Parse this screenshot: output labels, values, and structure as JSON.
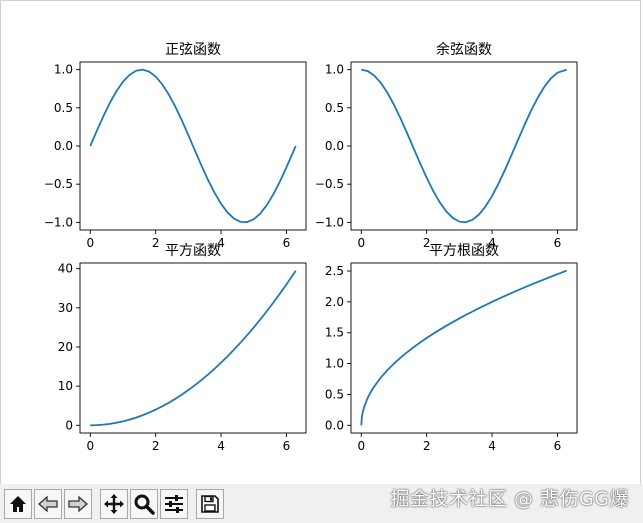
{
  "chart_data": [
    {
      "type": "line",
      "title": "正弦函数",
      "xlim": [
        -0.3141,
        6.5973
      ],
      "ylim": [
        -1.1,
        1.1
      ],
      "xticks": [
        0,
        2,
        4,
        6
      ],
      "yticks": [
        -1.0,
        -0.5,
        0.0,
        0.5,
        1.0
      ],
      "ytick_labels": [
        "−1.0",
        "−0.5",
        "0.0",
        "0.5",
        "1.0"
      ],
      "x": [
        0,
        0.2,
        0.4,
        0.6,
        0.8,
        1.0,
        1.2,
        1.4,
        1.6,
        1.8,
        2.0,
        2.2,
        2.4,
        2.6,
        2.8,
        3.0,
        3.2,
        3.4,
        3.6,
        3.8,
        4.0,
        4.2,
        4.4,
        4.6,
        4.8,
        5.0,
        5.2,
        5.4,
        5.6,
        5.8,
        6.0,
        6.283
      ],
      "y": [
        0,
        0.199,
        0.389,
        0.565,
        0.717,
        0.841,
        0.932,
        0.985,
        1.0,
        0.974,
        0.909,
        0.808,
        0.675,
        0.516,
        0.335,
        0.141,
        -0.058,
        -0.256,
        -0.443,
        -0.612,
        -0.757,
        -0.872,
        -0.952,
        -0.994,
        -0.996,
        -0.959,
        -0.883,
        -0.773,
        -0.631,
        -0.465,
        -0.279,
        0.0
      ],
      "color": "#1f77b4"
    },
    {
      "type": "line",
      "title": "余弦函数",
      "xlim": [
        -0.3141,
        6.5973
      ],
      "ylim": [
        -1.1,
        1.1
      ],
      "xticks": [
        0,
        2,
        4,
        6
      ],
      "yticks": [
        -1.0,
        -0.5,
        0.0,
        0.5,
        1.0
      ],
      "ytick_labels": [
        "−1.0",
        "−0.5",
        "0.0",
        "0.5",
        "1.0"
      ],
      "x": [
        0,
        0.2,
        0.4,
        0.6,
        0.8,
        1.0,
        1.2,
        1.4,
        1.6,
        1.8,
        2.0,
        2.2,
        2.4,
        2.6,
        2.8,
        3.0,
        3.2,
        3.4,
        3.6,
        3.8,
        4.0,
        4.2,
        4.4,
        4.6,
        4.8,
        5.0,
        5.2,
        5.4,
        5.6,
        5.8,
        6.0,
        6.283
      ],
      "y": [
        1.0,
        0.98,
        0.921,
        0.825,
        0.697,
        0.54,
        0.362,
        0.17,
        -0.029,
        -0.227,
        -0.416,
        -0.589,
        -0.737,
        -0.857,
        -0.942,
        -0.99,
        -0.998,
        -0.967,
        -0.897,
        -0.791,
        -0.654,
        -0.49,
        -0.307,
        -0.112,
        0.087,
        0.284,
        0.469,
        0.635,
        0.776,
        0.886,
        0.96,
        1.0
      ],
      "color": "#1f77b4"
    },
    {
      "type": "line",
      "title": "平方函数",
      "xlim": [
        -0.3141,
        6.5973
      ],
      "ylim": [
        -1.97,
        41.45
      ],
      "xticks": [
        0,
        2,
        4,
        6
      ],
      "yticks": [
        0,
        10,
        20,
        30,
        40
      ],
      "ytick_labels": [
        "0",
        "10",
        "20",
        "30",
        "40"
      ],
      "x": [
        0,
        0.2,
        0.4,
        0.6,
        0.8,
        1.0,
        1.2,
        1.4,
        1.6,
        1.8,
        2.0,
        2.2,
        2.4,
        2.6,
        2.8,
        3.0,
        3.2,
        3.4,
        3.6,
        3.8,
        4.0,
        4.2,
        4.4,
        4.6,
        4.8,
        5.0,
        5.2,
        5.4,
        5.6,
        5.8,
        6.0,
        6.283
      ],
      "y": [
        0,
        0.04,
        0.16,
        0.36,
        0.64,
        1.0,
        1.44,
        1.96,
        2.56,
        3.24,
        4.0,
        4.84,
        5.76,
        6.76,
        7.84,
        9.0,
        10.24,
        11.56,
        12.96,
        14.44,
        16.0,
        17.64,
        19.36,
        21.16,
        23.04,
        25.0,
        27.04,
        29.16,
        31.36,
        33.64,
        36.0,
        39.48
      ],
      "color": "#1f77b4"
    },
    {
      "type": "line",
      "title": "平方根函数",
      "xlim": [
        -0.3141,
        6.5973
      ],
      "ylim": [
        -0.125,
        2.63
      ],
      "xticks": [
        0,
        2,
        4,
        6
      ],
      "yticks": [
        0.0,
        0.5,
        1.0,
        1.5,
        2.0,
        2.5
      ],
      "ytick_labels": [
        "0.0",
        "0.5",
        "1.0",
        "1.5",
        "2.0",
        "2.5"
      ],
      "x": [
        0,
        0.02,
        0.05,
        0.1,
        0.2,
        0.3,
        0.4,
        0.6,
        0.8,
        1.0,
        1.2,
        1.4,
        1.6,
        1.8,
        2.0,
        2.2,
        2.4,
        2.6,
        2.8,
        3.0,
        3.2,
        3.4,
        3.6,
        3.8,
        4.0,
        4.2,
        4.4,
        4.6,
        4.8,
        5.0,
        5.2,
        5.4,
        5.6,
        5.8,
        6.0,
        6.283
      ],
      "y": [
        0,
        0.141,
        0.224,
        0.316,
        0.447,
        0.548,
        0.632,
        0.775,
        0.894,
        1.0,
        1.095,
        1.183,
        1.265,
        1.342,
        1.414,
        1.483,
        1.549,
        1.612,
        1.673,
        1.732,
        1.789,
        1.844,
        1.897,
        1.949,
        2.0,
        2.049,
        2.098,
        2.145,
        2.191,
        2.236,
        2.28,
        2.324,
        2.366,
        2.408,
        2.449,
        2.507
      ],
      "color": "#1f77b4"
    }
  ],
  "toolbar": {
    "home_icon": "home-icon",
    "back_icon": "arrow-left-icon",
    "forward_icon": "arrow-right-icon",
    "pan_icon": "move-icon",
    "zoom_icon": "magnifier-icon",
    "configure_icon": "sliders-icon",
    "save_icon": "floppy-disk-icon"
  },
  "watermark": "掘金技术社区 @ 悲伤GG爆"
}
